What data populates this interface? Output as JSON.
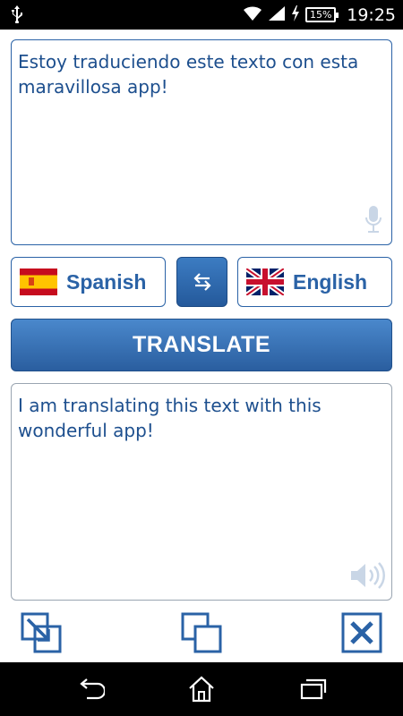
{
  "status_bar": {
    "battery_percent": "15%",
    "time": "19:25",
    "icons": [
      "usb-icon",
      "wifi-icon",
      "signal-icon",
      "charging-icon",
      "battery-icon"
    ]
  },
  "source": {
    "text": "Estoy traduciendo este texto con esta maravillosa app!",
    "icon": "microphone-icon"
  },
  "languages": {
    "from": {
      "label": "Spanish",
      "icon": "spain-flag-icon"
    },
    "to": {
      "label": "English",
      "icon": "uk-flag-icon"
    },
    "swap_icon": "swap-arrows-icon"
  },
  "translate_button": {
    "label": "TRANSLATE"
  },
  "result": {
    "text": "I am translating this text with this wonderful app!",
    "icon": "speaker-icon"
  },
  "actions": [
    "share-icon",
    "copy-icon",
    "clear-icon"
  ],
  "nav_bar": [
    "back-icon",
    "home-icon",
    "recent-apps-icon"
  ],
  "colors": {
    "accent": "#2a62a6",
    "text": "#1d4f8e",
    "button_top": "#4a88cc",
    "button_bottom": "#2a5e9f"
  }
}
